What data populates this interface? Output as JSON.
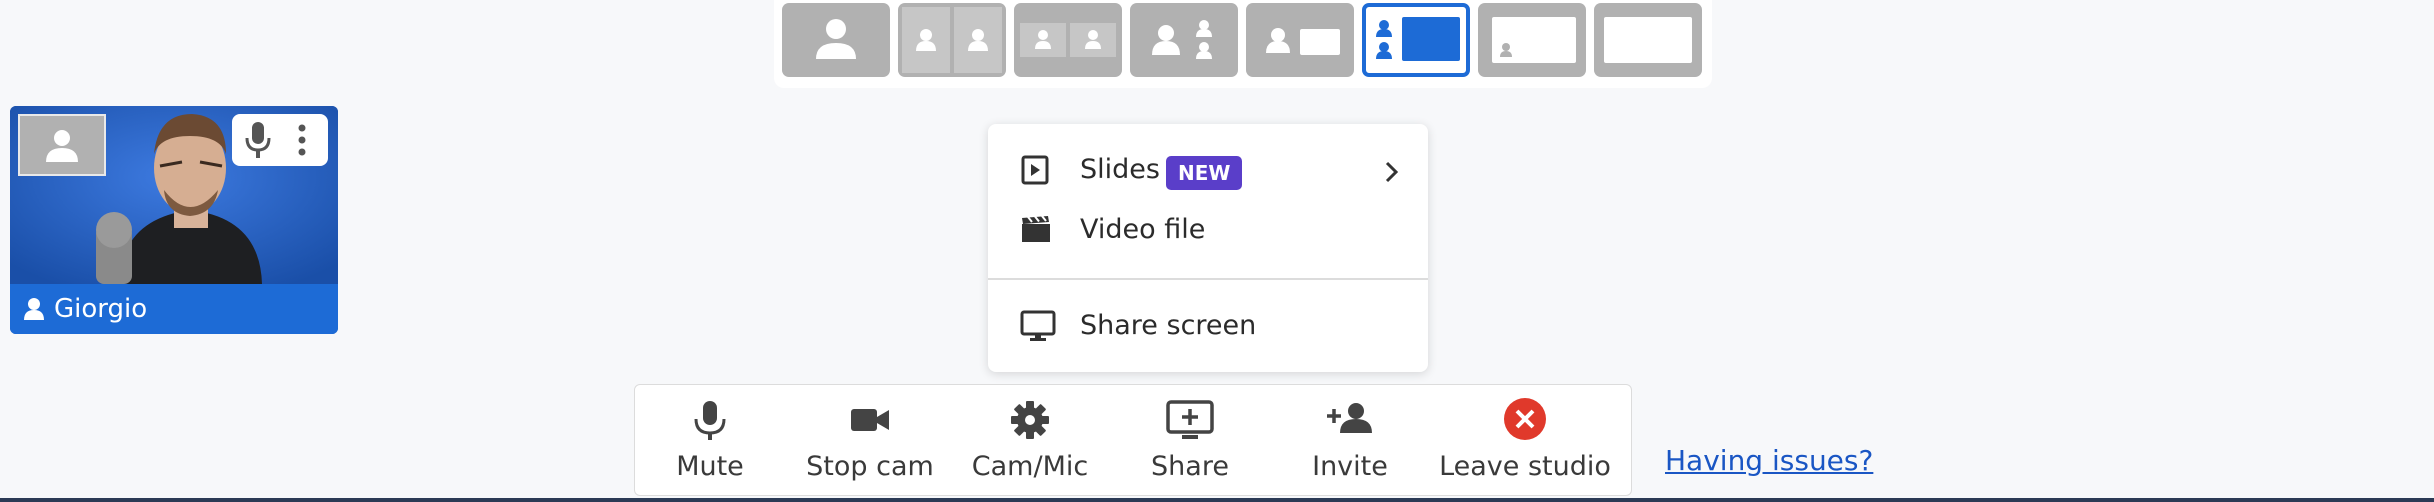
{
  "layout_selector": {
    "options": [
      {
        "name": "solo",
        "selected": false
      },
      {
        "name": "side-by-side",
        "selected": false
      },
      {
        "name": "small-side-by-side",
        "selected": false
      },
      {
        "name": "group",
        "selected": false
      },
      {
        "name": "person-with-screen",
        "selected": false
      },
      {
        "name": "sidebar-screen",
        "selected": true
      },
      {
        "name": "screen-with-thumbnail",
        "selected": false
      },
      {
        "name": "screen-only",
        "selected": false
      }
    ],
    "selected_color": "#1d6bd6"
  },
  "participant": {
    "name": "Giorgio",
    "icons": [
      "person-icon",
      "microphone-icon",
      "more-vertical-icon"
    ]
  },
  "share_menu": {
    "items": [
      {
        "label": "Slides",
        "badge": "NEW",
        "icon": "present-icon",
        "has_submenu": true
      },
      {
        "label": "Video file",
        "icon": "film-icon"
      },
      {
        "label": "Share screen",
        "icon": "monitor-icon"
      }
    ],
    "badge_color": "#5a3ec9"
  },
  "toolbar": {
    "mute": "Mute",
    "stop_cam": "Stop cam",
    "cam_mic": "Cam/Mic",
    "share": "Share",
    "invite": "Invite",
    "leave": "Leave studio",
    "leave_color": "#e0392b"
  },
  "help_link": "Having issues?"
}
